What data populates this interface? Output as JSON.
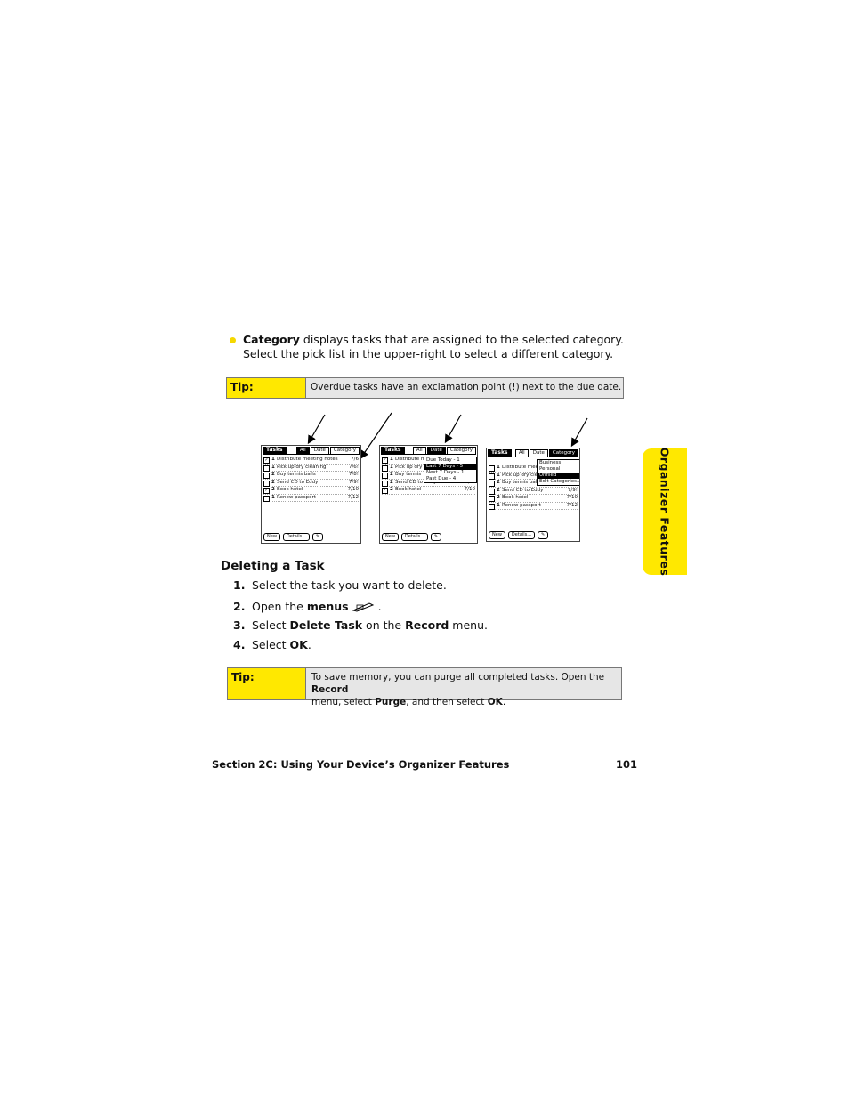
{
  "bullet": {
    "label": "Category",
    "text": " displays tasks that are assigned to the selected category. Select the pick list in the upper-right to select a different category."
  },
  "tip1": {
    "label": "Tip:",
    "text": "Overdue tasks have an exclamation point (!) next to the due date."
  },
  "screens": {
    "s1": {
      "title": "Tasks",
      "tabs": [
        "All",
        "Date",
        "Category"
      ],
      "rows": [
        {
          "check": "✓",
          "prio": "1",
          "name": "Distribute meeting notes",
          "date": "7/6"
        },
        {
          "check": "",
          "prio": "1",
          "name": "Pick up dry cleaning",
          "date": "7/6!"
        },
        {
          "check": "",
          "prio": "2",
          "name": "Buy tennis balls",
          "date": "7/8!"
        },
        {
          "check": "",
          "prio": "2",
          "name": "Send CD to Eddy",
          "date": "7/9!"
        },
        {
          "check": "✓",
          "prio": "2",
          "name": "Book hotel",
          "date": "7/10"
        },
        {
          "check": "",
          "prio": "1",
          "name": "Renew passport",
          "date": "7/12"
        }
      ],
      "buttons": [
        "New",
        "Details...",
        "✎"
      ]
    },
    "s2": {
      "title": "Tasks",
      "tabs": [
        "All",
        "Date",
        "Category"
      ],
      "rows": [
        {
          "check": "✓",
          "prio": "1",
          "name": "Distribute m",
          "date": ""
        },
        {
          "check": "",
          "prio": "1",
          "name": "Pick up dry",
          "date": ""
        },
        {
          "check": "",
          "prio": "2",
          "name": "Buy tennis",
          "date": ""
        },
        {
          "check": "",
          "prio": "2",
          "name": "Send CD to Eddy",
          "date": "7/9!"
        },
        {
          "check": "✓",
          "prio": "2",
          "name": "Book hotel",
          "date": "7/10"
        }
      ],
      "popup": [
        "Due Today - 1",
        "Last 7 Days - 5",
        "Next 7 Days - 1",
        "Past Due - 4"
      ],
      "buttons": [
        "New",
        "Details...",
        "✎"
      ]
    },
    "s3": {
      "title": "Tasks",
      "tabs": [
        "All",
        "Date",
        "Category"
      ],
      "rows": [
        {
          "check": "",
          "prio": "1",
          "name": "Distribute mee",
          "date": ""
        },
        {
          "check": "",
          "prio": "1",
          "name": "Pick up dry cle",
          "date": ""
        },
        {
          "check": "",
          "prio": "2",
          "name": "Buy tennis ball",
          "date": ""
        },
        {
          "check": "",
          "prio": "2",
          "name": "Send CD to Eddy",
          "date": "7/9!"
        },
        {
          "check": "",
          "prio": "2",
          "name": "Book hotel",
          "date": "7/10"
        },
        {
          "check": "",
          "prio": "1",
          "name": "Renew passport",
          "date": "7/12"
        }
      ],
      "popup": [
        "Business",
        "Personal",
        "Unfiled",
        "Edit Categories..."
      ],
      "buttons": [
        "New",
        "Details...",
        "✎"
      ]
    }
  },
  "heading": "Deleting a Task",
  "steps": [
    {
      "num": "1.",
      "text": "Select the task you want to delete."
    },
    {
      "num": "2.",
      "pre": "Open the ",
      "bold": "menus",
      "post": " ."
    },
    {
      "num": "3.",
      "pre": "Select ",
      "bold": "Delete Task",
      "mid": " on the ",
      "bold2": "Record",
      "post": " menu."
    },
    {
      "num": "4.",
      "pre": "Select ",
      "bold": "OK",
      "post": "."
    }
  ],
  "tip2": {
    "label": "Tip:",
    "line1_pre": "To save memory, you can purge all completed tasks. Open the ",
    "line1_bold": "Record",
    "line2_pre": "menu, select  ",
    "line2_bold": "Purge",
    "line2_mid": ", and then select ",
    "line2_bold2": "OK",
    "line2_post": "."
  },
  "side_tab": "Organizer Features",
  "footer": {
    "section": "Section 2C: Using Your Device’s Organizer Features",
    "page": "101"
  }
}
